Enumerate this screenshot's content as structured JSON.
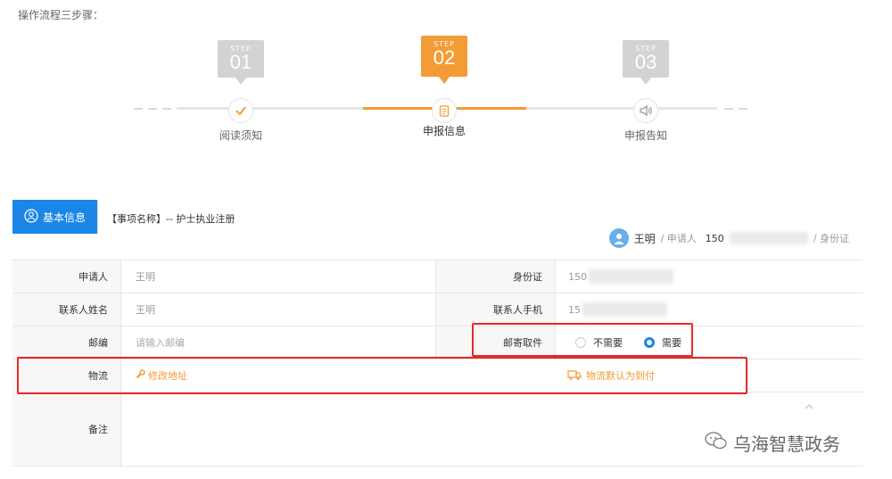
{
  "intro": "操作流程三步骤：",
  "steps": [
    {
      "word": "STEP",
      "num": "01",
      "label": "阅读须知",
      "icon": "check-icon",
      "color": "#cfcfcf",
      "active": false
    },
    {
      "word": "STEP",
      "num": "02",
      "label": "申报信息",
      "icon": "document-icon",
      "color": "#f39b35",
      "active": true
    },
    {
      "word": "STEP",
      "num": "03",
      "label": "申报告知",
      "icon": "speaker-icon",
      "color": "#cfcfcf",
      "active": false
    }
  ],
  "tab": {
    "label": "基本信息",
    "icon": "user-circle-icon"
  },
  "item_title": "【事项名称】-- 护士执业注册",
  "applicant": {
    "name": "王明",
    "role": "/ 申请人",
    "phone_prefix": "150",
    "id_suffix": "/ 身份证"
  },
  "table": {
    "rows": [
      {
        "l1": "申请人",
        "v1": "王明",
        "l2": "身份证",
        "v2": "150"
      },
      {
        "l1": "联系人姓名",
        "v1": "王明",
        "l2": "联系人手机",
        "v2": "15"
      },
      {
        "l1": "邮编",
        "v1_placeholder": "请输入邮编",
        "l2": "邮寄取件",
        "opt_no": "不需要",
        "opt_yes": "需要"
      },
      {
        "l1": "物流",
        "v1": "修改地址",
        "v2": "物流默认为到付"
      },
      {
        "l1": "备注",
        "v1": ""
      }
    ]
  },
  "watermark": "乌海智慧政务",
  "colors": {
    "accent": "#1b86e6",
    "orange": "#f39b35",
    "highlight": "#e52828"
  }
}
